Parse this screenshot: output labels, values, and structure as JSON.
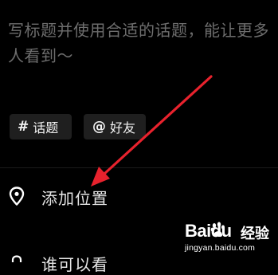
{
  "post": {
    "caption_placeholder": "写标题并使用合适的话题，能让更多人看到～"
  },
  "chips": {
    "topic": {
      "symbol": "#",
      "label": "话题"
    },
    "friend": {
      "symbol": "@",
      "label": "好友"
    }
  },
  "options": {
    "location_label": "添加位置",
    "privacy_label": "谁可以看"
  },
  "watermark": {
    "brand": "Baidu",
    "brand_cn": "经验",
    "url": "jingyan.baidu.com"
  },
  "colors": {
    "background": "#000000",
    "placeholder": "#6d6d6d",
    "chip_bg": "#1f1f1f",
    "annotation_arrow": "#e8222d"
  }
}
